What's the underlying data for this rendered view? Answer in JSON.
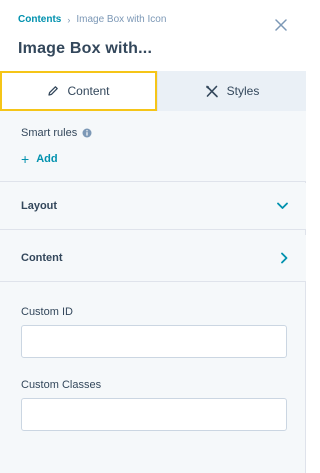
{
  "breadcrumb": {
    "parent": "Contents",
    "separator": "›",
    "current": "Image Box with Icon"
  },
  "header": {
    "title": "Image Box with..."
  },
  "tabs": [
    {
      "label": "Content",
      "icon": "pencil-icon",
      "active": true
    },
    {
      "label": "Styles",
      "icon": "styles-icon",
      "active": false
    }
  ],
  "smart_rules": {
    "label": "Smart rules",
    "add_label": "Add",
    "add_symbol": "+"
  },
  "sections": [
    {
      "label": "Layout",
      "state": "collapsed-down"
    },
    {
      "label": "Content",
      "state": "collapsed-right"
    }
  ],
  "fields": {
    "custom_id": {
      "label": "Custom ID",
      "value": ""
    },
    "custom_classes": {
      "label": "Custom Classes",
      "value": ""
    }
  },
  "colors": {
    "link": "#0091ae",
    "text": "#33475b",
    "focus_outline": "#f5c518",
    "panel_bg": "#f5f8fa"
  }
}
